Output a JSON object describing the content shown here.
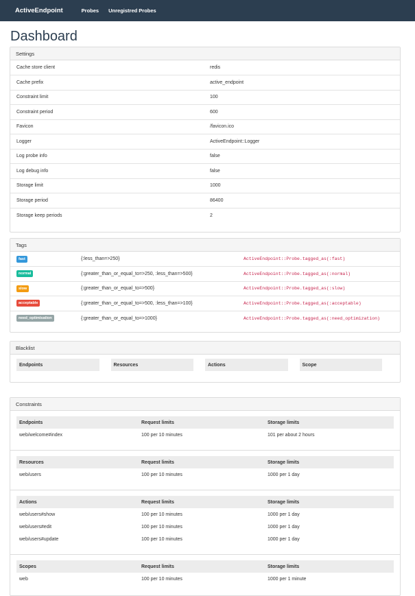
{
  "nav": {
    "brand": "ActiveEndpoint",
    "links": [
      "Probes",
      "Unregistred Probes"
    ]
  },
  "page_title": "Dashboard",
  "settings": {
    "title": "Settings",
    "rows": [
      {
        "key": "Cache store client",
        "value": "redis"
      },
      {
        "key": "Cache prefix",
        "value": "active_endpoint"
      },
      {
        "key": "Constraint limit",
        "value": "100"
      },
      {
        "key": "Constraint period",
        "value": "600"
      },
      {
        "key": "Favicon",
        "value": "/favicon.ico"
      },
      {
        "key": "Logger",
        "value": "ActiveEndpoint::Logger"
      },
      {
        "key": "Log probe info",
        "value": "false"
      },
      {
        "key": "Log debug info",
        "value": "false"
      },
      {
        "key": "Storage limit",
        "value": "1000"
      },
      {
        "key": "Storage period",
        "value": "86400"
      },
      {
        "key": "Storage keep periods",
        "value": "2"
      }
    ]
  },
  "tags": {
    "title": "Tags",
    "rows": [
      {
        "label": "fast",
        "color": "#3498db",
        "condition": "{:less_than=>250}",
        "code": "ActiveEndpoint::Probe.tagged_as(:fast)"
      },
      {
        "label": "normal",
        "color": "#18bc9c",
        "condition": "{:greater_than_or_equal_to=>250, :less_than=>500}",
        "code": "ActiveEndpoint::Probe.tagged_as(:normal)"
      },
      {
        "label": "slow",
        "color": "#f39c12",
        "condition": "{:greater_than_or_equal_to=>500}",
        "code": "ActiveEndpoint::Probe.tagged_as(:slow)"
      },
      {
        "label": "acceptable",
        "color": "#e74c3c",
        "condition": "{:greater_than_or_equal_to=>500, :less_than=>100}",
        "code": "ActiveEndpoint::Probe.tagged_as(:acceptable)"
      },
      {
        "label": "need_optimisation",
        "color": "#95a5a6",
        "condition": "{:greater_than_or_equal_to=>1000}",
        "code": "ActiveEndpoint::Probe.tagged_as(:need_optimization)"
      }
    ]
  },
  "blacklist": {
    "title": "Blacklist",
    "headers": [
      "Endpoints",
      "Resources",
      "Actions",
      "Scope"
    ]
  },
  "constraints": {
    "title": "Constraints",
    "groups": [
      {
        "headers": [
          "Endpoints",
          "Request limits",
          "Storage limits"
        ],
        "rows": [
          [
            "web/welcome#index",
            "100 per 10 minutes",
            "101 per about 2 hours"
          ]
        ]
      },
      {
        "headers": [
          "Resources",
          "Request limits",
          "Storage limits"
        ],
        "rows": [
          [
            "web/users",
            "100 per 10 minutes",
            "1000 per 1 day"
          ]
        ]
      },
      {
        "headers": [
          "Actions",
          "Request limits",
          "Storage limits"
        ],
        "rows": [
          [
            "web/users#show",
            "100 per 10 minutes",
            "1000 per 1 day"
          ],
          [
            "web/users#edit",
            "100 per 10 minutes",
            "1000 per 1 day"
          ],
          [
            "web/users#update",
            "100 per 10 minutes",
            "1000 per 1 day"
          ]
        ]
      },
      {
        "headers": [
          "Scopes",
          "Request limits",
          "Storage limits"
        ],
        "rows": [
          [
            "web",
            "100 per 10 minutes",
            "1000 per 1 minute"
          ]
        ]
      }
    ]
  }
}
